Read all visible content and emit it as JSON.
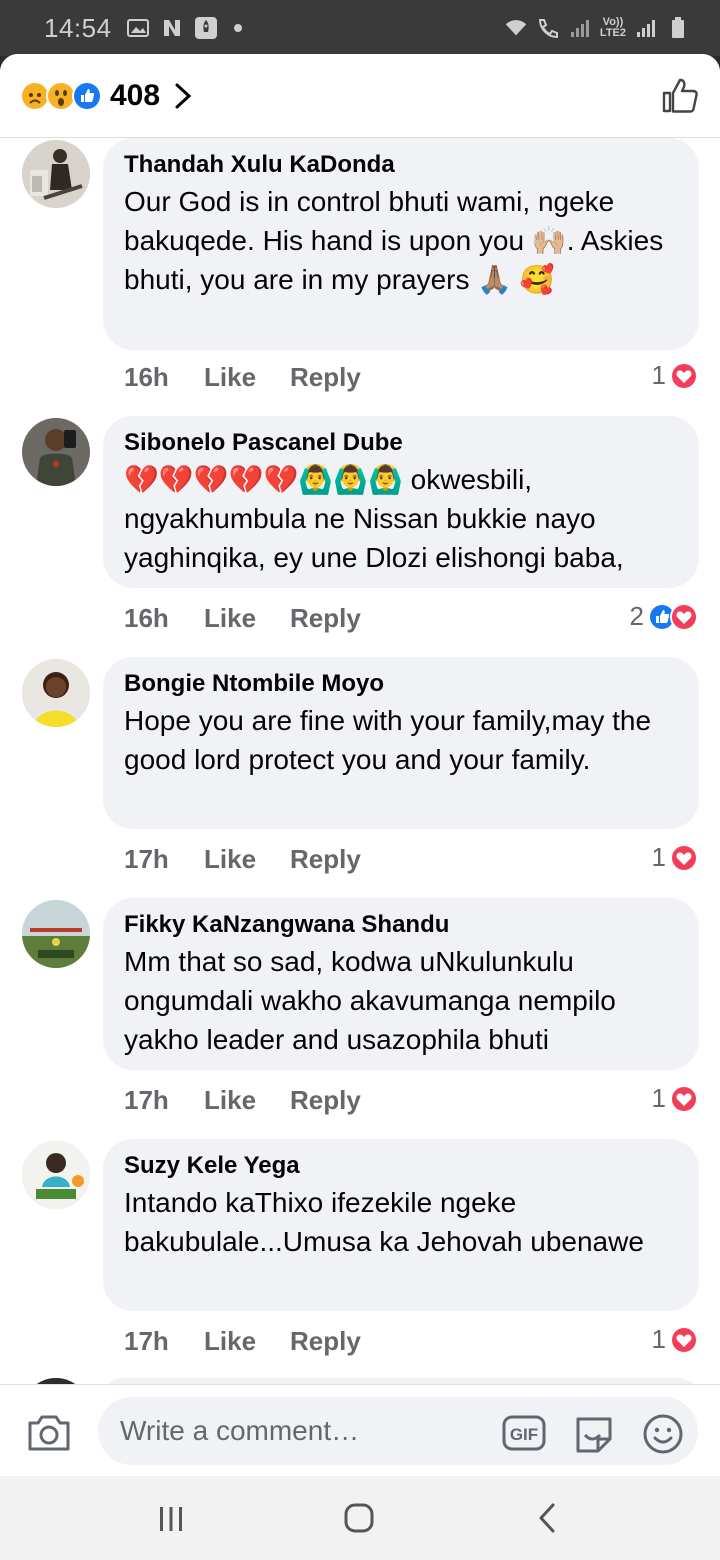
{
  "status_bar": {
    "time": "14:54",
    "network_label_top": "Vo))",
    "network_label_bottom": "LTE2"
  },
  "header": {
    "reaction_icons": [
      "sad-reaction-icon",
      "wow-reaction-icon",
      "like-reaction-icon"
    ],
    "reaction_count": "408"
  },
  "comments": [
    {
      "author": "Thandah Xulu KaDonda",
      "text": "Our God is in control bhuti wami, ngeke bakuqede. His hand is upon you 🙌🏼. Askies bhuti, you are in my prayers 🙏🏽 🥰",
      "time": "16h",
      "like_label": "Like",
      "reply_label": "Reply",
      "reaction_count": "1",
      "reactions": [
        "love"
      ]
    },
    {
      "author": "Sibonelo Pascanel Dube",
      "text": "💔💔💔💔💔🙆‍♂️🙆‍♂️🙆‍♂️ okwesbili, ngyakhumbula ne Nissan bukkie nayo yaghinqika, ey une Dlozi elishongi baba,",
      "time": "16h",
      "like_label": "Like",
      "reply_label": "Reply",
      "reaction_count": "2",
      "reactions": [
        "like",
        "love"
      ]
    },
    {
      "author": "Bongie Ntombile Moyo",
      "text": "Hope you are fine  with your family,may the good  lord  protect  you and your family.",
      "time": "17h",
      "like_label": "Like",
      "reply_label": "Reply",
      "reaction_count": "1",
      "reactions": [
        "love"
      ]
    },
    {
      "author": "Fikky KaNzangwana Shandu",
      "text": "Mm that so sad, kodwa uNkulunkulu ongumdali wakho akavumanga nempilo yakho leader and usazophila bhuti",
      "time": "17h",
      "like_label": "Like",
      "reply_label": "Reply",
      "reaction_count": "1",
      "reactions": [
        "love"
      ]
    },
    {
      "author": "Suzy Kele Yega",
      "text": "Intando kaThixo ifezekile ngeke bakubulale...Umusa ka Jehovah ubenawe",
      "time": "17h",
      "like_label": "Like",
      "reply_label": "Reply",
      "reaction_count": "1",
      "reactions": [
        "love"
      ]
    }
  ],
  "composer": {
    "placeholder": "Write a comment…",
    "gif_label": "GIF"
  },
  "colors": {
    "like_blue": "#1877f2",
    "love_red": "#f33e58",
    "meta_gray": "#65676b",
    "bubble_bg": "#f0f2f5"
  }
}
